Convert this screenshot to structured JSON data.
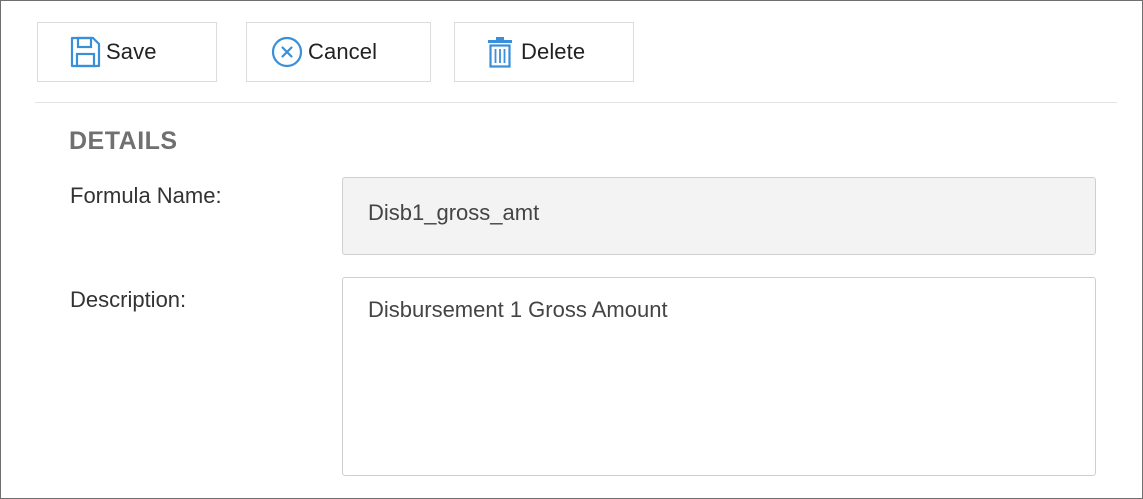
{
  "toolbar": {
    "save_label": "Save",
    "cancel_label": "Cancel",
    "delete_label": "Delete",
    "save_icon": "floppy-disk-icon",
    "cancel_icon": "circle-x-icon",
    "delete_icon": "trash-can-icon",
    "icon_color": "#3a8fd9"
  },
  "details": {
    "section_title": "DETAILS",
    "formula_name_label": "Formula Name:",
    "formula_name_value": "Disb1_gross_amt",
    "description_label": "Description:",
    "description_value": "Disbursement 1 Gross Amount"
  }
}
